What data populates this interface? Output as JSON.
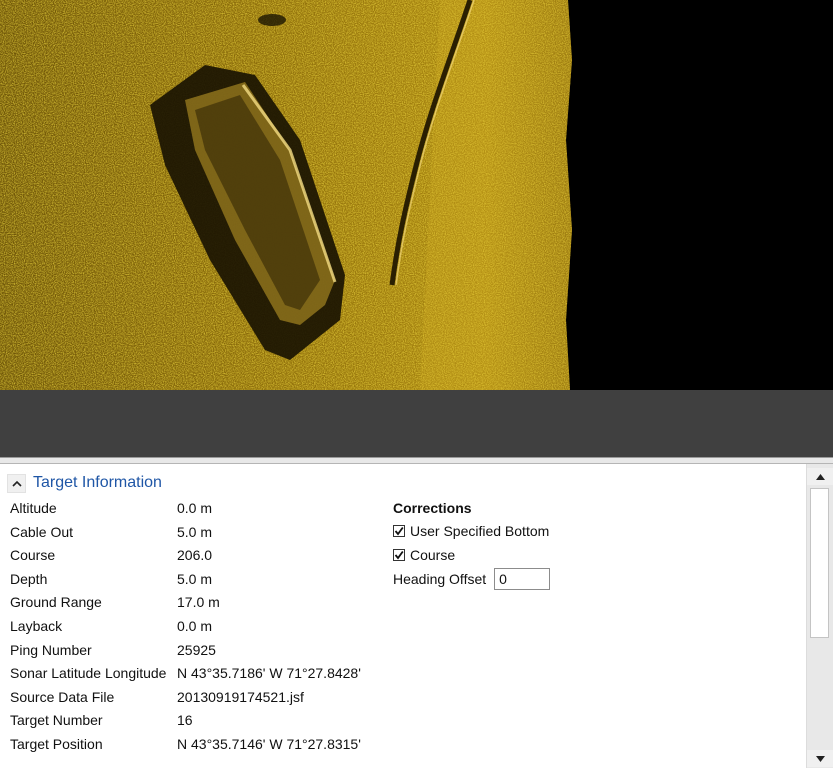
{
  "target_info": {
    "title": "Target Information",
    "properties": [
      {
        "label": "Altitude",
        "value": "0.0 m"
      },
      {
        "label": "Cable Out",
        "value": "5.0 m"
      },
      {
        "label": "Course",
        "value": "206.0"
      },
      {
        "label": "Depth",
        "value": "5.0 m"
      },
      {
        "label": "Ground Range",
        "value": "17.0 m"
      },
      {
        "label": "Layback",
        "value": "0.0 m"
      },
      {
        "label": "Ping Number",
        "value": "25925"
      },
      {
        "label": "Sonar Latitude Longitude",
        "value": "N 43°35.7186' W 71°27.8428'"
      },
      {
        "label": "Source Data File",
        "value": "20130919174521.jsf"
      },
      {
        "label": "Target Number",
        "value": "16"
      },
      {
        "label": "Target Position",
        "value": "N 43°35.7146' W 71°27.8315'"
      }
    ]
  },
  "corrections": {
    "title": "Corrections",
    "user_specified_bottom": {
      "label": "User Specified Bottom",
      "checked": true
    },
    "course": {
      "label": "Course",
      "checked": true
    },
    "heading_offset": {
      "label": "Heading Offset",
      "value": "0"
    }
  },
  "icons": {
    "collapse": "chevron-up-icon",
    "scroll_up": "arrow-up-icon",
    "scroll_down": "arrow-down-icon"
  },
  "colors": {
    "sonar_gold": "#b8930f",
    "section_title": "#1f56a6",
    "gray_strip": "#404040"
  }
}
